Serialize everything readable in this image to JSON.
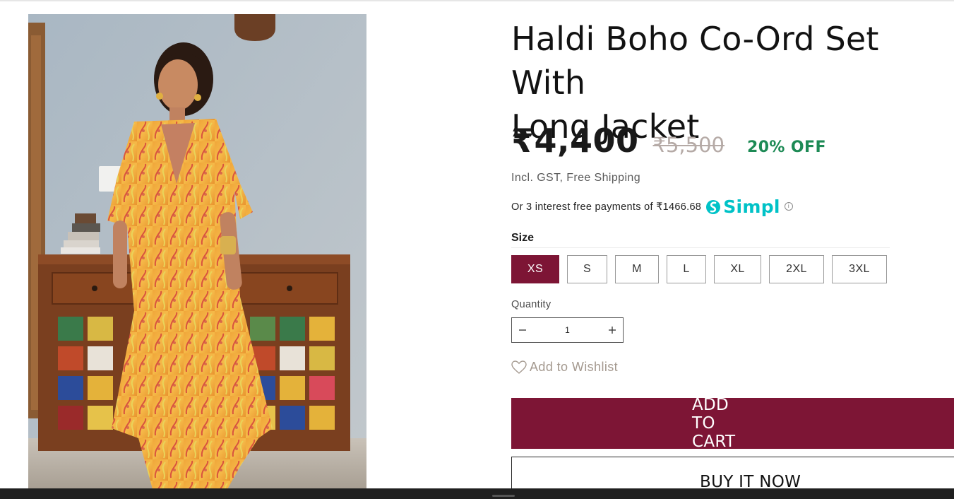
{
  "product": {
    "title": "Haldi Boho Co-Ord Set With\nLong Jacket",
    "image_alt": "Woman wearing a yellow paisley printed co-ord set with long jacket"
  },
  "pricing": {
    "sale_price": "₹4,400",
    "compare_price": "₹5,500",
    "discount": "20% OFF",
    "tax_note": "Incl. GST, Free Shipping"
  },
  "emi": {
    "text": "Or 3 interest free payments of ₹1466.68",
    "provider": "Simpl",
    "info_icon": "info-icon"
  },
  "size": {
    "label": "Size",
    "options": [
      "XS",
      "S",
      "M",
      "L",
      "XL",
      "2XL",
      "3XL"
    ],
    "selected": "XS"
  },
  "quantity": {
    "label": "Quantity",
    "value": "1",
    "decrement_icon": "minus-icon",
    "increment_icon": "plus-icon"
  },
  "wishlist": {
    "label": "Add to Wishlist",
    "icon": "heart-icon"
  },
  "actions": {
    "add_to_cart": "ADD TO CART",
    "buy_now": "BUY IT NOW"
  },
  "colors": {
    "brand": "#7d1535",
    "discount": "#1d8a55",
    "simpl": "#00c2c7",
    "compare_price": "#b5aaa6"
  }
}
